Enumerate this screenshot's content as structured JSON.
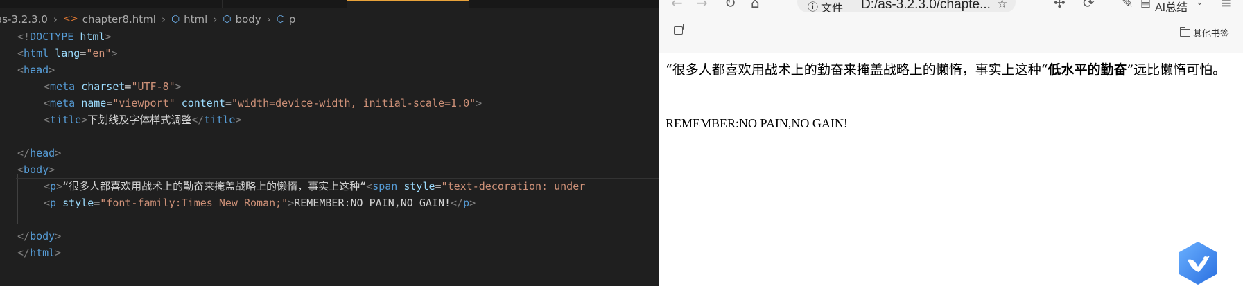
{
  "editor": {
    "breadcrumb": {
      "folder": "as-3.2.3.0",
      "file": "chapter8.html",
      "html": "html",
      "body": "body",
      "p": "p"
    },
    "lines": {
      "doctype_open": "<!",
      "doctype_kw": "DOCTYPE",
      "doctype_name": "html",
      "html_tag": "html",
      "lang_attr": "lang",
      "lang_val": "\"en\"",
      "head_tag": "head",
      "meta_tag": "meta",
      "charset_attr": "charset",
      "charset_val": "\"UTF-8\"",
      "name_attr": "name",
      "name_val": "\"viewport\"",
      "content_attr": "content",
      "content_val": "\"width=device-width, initial-scale=1.0\"",
      "title_tag": "title",
      "title_text": "下划线及字体样式调整",
      "body_tag": "body",
      "p_tag": "p",
      "p1_text": "“很多人都喜欢用战术上的勤奋来掩盖战略上的懒惰，事实上这种“",
      "span_tag": "span",
      "style_attr": "style",
      "p1_style_val": "\"text-decoration: under",
      "p2_style_val": "\"font-family:Times New Roman;\"",
      "p2_text": "REMEMBER:NO PAIN,NO GAIN!"
    }
  },
  "browser": {
    "address_label": "文件",
    "address_url": "D:/as-3.2.3.0/chapte...",
    "ai_summary": "AI总结",
    "other_bookmarks": "其他书签",
    "content": {
      "para1_before": "“很多人都喜欢用战术上的勤奋来掩盖战略上的懒惰，事实上这种“",
      "para1_underlined": "低水平的勤奋",
      "para1_after": "”远比懒惰可怕。",
      "para2": "REMEMBER:NO PAIN,NO GAIN!"
    }
  },
  "colors": {
    "editor_bg": "#1f1f1f",
    "tag": "#569cd6",
    "attr_name": "#9cdcfe",
    "attr_value": "#ce9178",
    "browser_bg": "#ffffff"
  },
  "icons": [
    "html-file-icon",
    "symbol-cube-icon",
    "back-icon",
    "forward-icon",
    "refresh-icon",
    "home-icon",
    "info-icon",
    "star-icon",
    "extensions-icon",
    "ai-icon",
    "tab-actions-icon",
    "folder-icon",
    "bird-app-icon"
  ]
}
